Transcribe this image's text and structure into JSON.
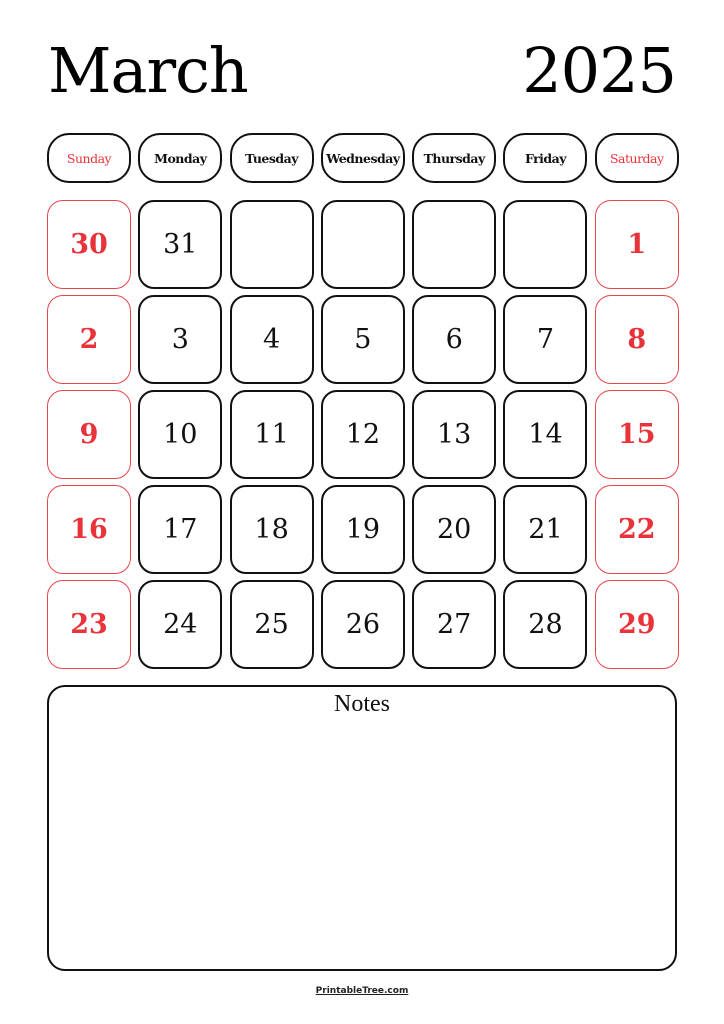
{
  "header": {
    "month": "March",
    "year": "2025"
  },
  "colors": {
    "weekend": "#e8333a",
    "text": "#111111"
  },
  "weekdays": [
    {
      "label": "Sunday",
      "weekend": true
    },
    {
      "label": "Monday",
      "weekend": false
    },
    {
      "label": "Tuesday",
      "weekend": false
    },
    {
      "label": "Wednesday",
      "weekend": false
    },
    {
      "label": "Thursday",
      "weekend": false
    },
    {
      "label": "Friday",
      "weekend": false
    },
    {
      "label": "Saturday",
      "weekend": true
    }
  ],
  "weeks": [
    [
      "30",
      "31",
      "",
      "",
      "",
      "",
      "1"
    ],
    [
      "2",
      "3",
      "4",
      "5",
      "6",
      "7",
      "8"
    ],
    [
      "9",
      "10",
      "11",
      "12",
      "13",
      "14",
      "15"
    ],
    [
      "16",
      "17",
      "18",
      "19",
      "20",
      "21",
      "22"
    ],
    [
      "23",
      "24",
      "25",
      "26",
      "27",
      "28",
      "29"
    ]
  ],
  "notes": {
    "title": "Notes"
  },
  "footer": {
    "text": "PrintableTree.com"
  }
}
